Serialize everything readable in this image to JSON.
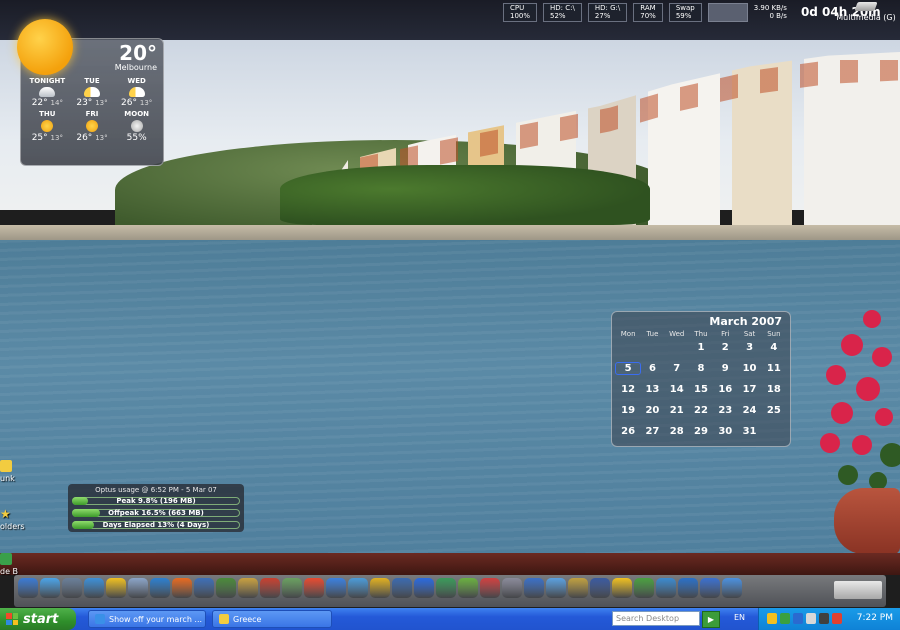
{
  "system_monitor": {
    "meters": [
      {
        "label": "CPU",
        "value": "100%"
      },
      {
        "label": "HD: C:\\",
        "value": "52%"
      },
      {
        "label": "HD: G:\\",
        "value": "27%"
      },
      {
        "label": "RAM",
        "value": "70%"
      },
      {
        "label": "Swap",
        "value": "59%"
      }
    ],
    "net_up": "3.90 KB/s",
    "net_down": "0 B/s",
    "uptime": "0d 04h 20m",
    "drive_label": "Multimedia (G)"
  },
  "weather": {
    "temperature": "20°",
    "city": "Melbourne",
    "forecast": [
      {
        "day": "TONIGHT",
        "icon": "cloudy-icon",
        "high": "22°",
        "low": "14°"
      },
      {
        "day": "TUE",
        "icon": "partly-sunny-icon",
        "high": "23°",
        "low": "13°"
      },
      {
        "day": "WED",
        "icon": "partly-sunny-icon",
        "high": "26°",
        "low": "13°"
      },
      {
        "day": "THU",
        "icon": "sunny-icon",
        "high": "25°",
        "low": "13°"
      },
      {
        "day": "FRI",
        "icon": "sunny-icon",
        "high": "26°",
        "low": "13°"
      },
      {
        "day": "MOON",
        "icon": "moon-icon",
        "high": "55%",
        "low": ""
      }
    ]
  },
  "calendar": {
    "title": "March 2007",
    "weekdays": [
      "Mon",
      "Tue",
      "Wed",
      "Thu",
      "Fri",
      "Sat",
      "Sun"
    ],
    "weeks": [
      [
        "",
        "",
        "",
        "1",
        "2",
        "3",
        "4"
      ],
      [
        "5",
        "6",
        "7",
        "8",
        "9",
        "10",
        "11"
      ],
      [
        "12",
        "13",
        "14",
        "15",
        "16",
        "17",
        "18"
      ],
      [
        "19",
        "20",
        "21",
        "22",
        "23",
        "24",
        "25"
      ],
      [
        "26",
        "27",
        "28",
        "29",
        "30",
        "31",
        ""
      ]
    ],
    "today": "5"
  },
  "usage": {
    "title": "Optus usage @ 6:52 PM - 5 Mar 07",
    "rows": [
      {
        "label": "Peak 9.8% (196 MB)",
        "fraction": 0.098
      },
      {
        "label": "Offpeak 16.5% (663 MB)",
        "fraction": 0.165
      },
      {
        "label": "Days Elapsed 13% (4 Days)",
        "fraction": 0.13
      }
    ]
  },
  "desktop_icons": [
    "unk",
    "olders",
    "de B"
  ],
  "dock": {
    "icon_colors": [
      "#3a7bd5",
      "#4aa3e8",
      "#6a7f9a",
      "#3c8fd8",
      "#f0c020",
      "#8aa4c8",
      "#2c7fd0",
      "#e86a20",
      "#3d6fb8",
      "#4a8a3a",
      "#c8a040",
      "#c84030",
      "#6aa060",
      "#e84a30",
      "#3a80e0",
      "#4a9ad8",
      "#e0b020",
      "#3a6ab0",
      "#2a6ae0",
      "#3a9a5a",
      "#6ab040",
      "#d04040",
      "#8a8a9a",
      "#3a70c8",
      "#5aa0e0",
      "#c0a040",
      "#3a5aa0",
      "#f0c020",
      "#4aa040",
      "#3a8ad0",
      "#2a70c8",
      "#3a70d0",
      "#4a90e0"
    ]
  },
  "taskbar": {
    "start_label": "start",
    "tasks": [
      {
        "label": "Show off your march ...",
        "icon": "internet-explorer-icon"
      },
      {
        "label": "Greece",
        "icon": "folder-icon"
      }
    ],
    "search_placeholder": "Search Desktop",
    "search_go": "▶",
    "language": "EN",
    "clock": "7:22 PM"
  }
}
